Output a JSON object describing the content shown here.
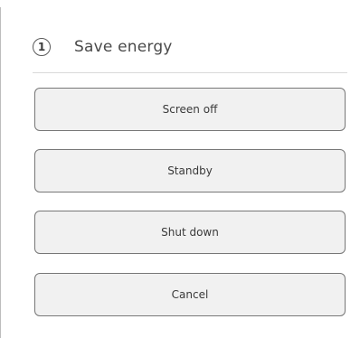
{
  "dialog": {
    "step_number": "1",
    "title": "Save energy"
  },
  "options": [
    {
      "label": "Screen off"
    },
    {
      "label": "Standby"
    },
    {
      "label": "Shut down"
    },
    {
      "label": "Cancel"
    }
  ]
}
